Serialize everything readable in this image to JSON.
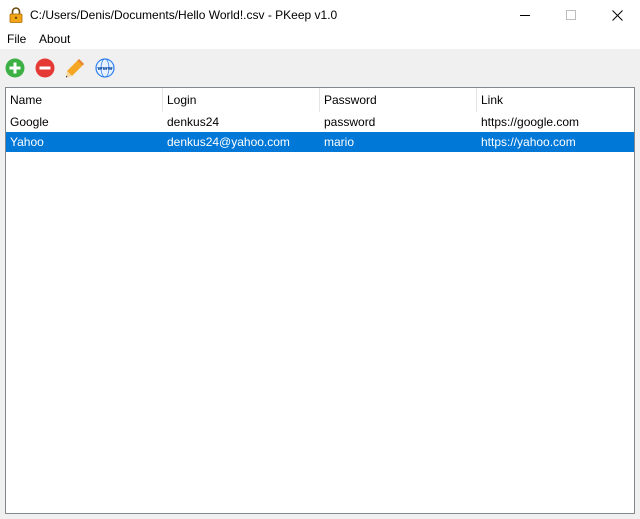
{
  "window": {
    "title": "C:/Users/Denis/Documents/Hello World!.csv - PKeep v1.0",
    "app_icon": "lock-icon"
  },
  "menu": {
    "file": "File",
    "about": "About"
  },
  "toolbar": {
    "icons": [
      "add-icon",
      "remove-icon",
      "edit-pencil-icon",
      "web-globe-icon"
    ]
  },
  "table": {
    "columns": [
      "Name",
      "Login",
      "Password",
      "Link"
    ],
    "rows": [
      {
        "name": "Google",
        "login": "denkus24",
        "password": "password",
        "link": "https://google.com",
        "selected": false
      },
      {
        "name": "Yahoo",
        "login": "denkus24@yahoo.com",
        "password": "mario",
        "link": "https://yahoo.com",
        "selected": true
      }
    ]
  },
  "colors": {
    "selection": "#0078d7",
    "add": "#3cb043",
    "remove": "#e53935",
    "edit": "#f5a623",
    "web": "#2f80ed"
  }
}
